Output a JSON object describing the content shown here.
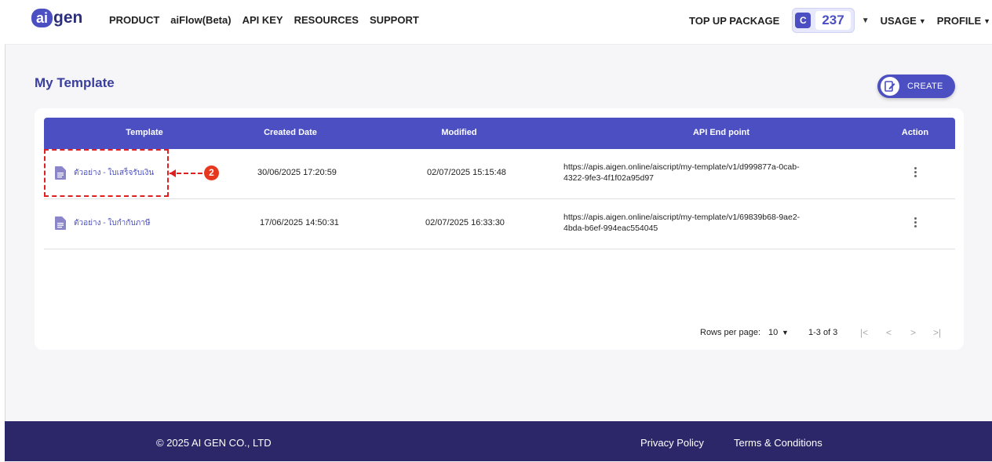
{
  "header": {
    "logo_ai": "ai",
    "logo_gen": "gen",
    "nav": [
      "PRODUCT",
      "aiFlow(Beta)",
      "API KEY",
      "RESOURCES",
      "SUPPORT"
    ],
    "topup": "TOP UP PACKAGE",
    "coin_letter": "C",
    "credits": "237",
    "usage": "USAGE",
    "profile": "PROFILE"
  },
  "page": {
    "title": "My Template",
    "create_label": "CREATE"
  },
  "table": {
    "headers": [
      "Template",
      "Created Date",
      "Modified",
      "API End point",
      "Action"
    ],
    "rows": [
      {
        "name": "ตัวอย่าง - ใบเสร็จรับเงิน",
        "created": "30/06/2025 17:20:59",
        "modified": "02/07/2025 15:15:48",
        "endpoint_line1": "https://apis.aigen.online/aiscript/my-template/v1/d999877a-0cab-",
        "endpoint_line2": "4322-9fe3-4f1f02a95d97"
      },
      {
        "name": "ตัวอย่าง - ใบกำกับภาษี",
        "created": "17/06/2025 14:50:31",
        "modified": "02/07/2025 16:33:30",
        "endpoint_line1": "https://apis.aigen.online/aiscript/my-template/v1/69839b68-9ae2-",
        "endpoint_line2": "4bda-b6ef-994eac554045"
      }
    ]
  },
  "pagination": {
    "rows_per_page_label": "Rows per page:",
    "rows_per_page_value": "10",
    "range": "1-3 of 3"
  },
  "annotation": {
    "step": "2"
  },
  "footer": {
    "copyright": "© 2025 AI GEN CO., LTD",
    "privacy": "Privacy Policy",
    "terms": "Terms & Conditions"
  },
  "colors": {
    "brand": "#4b4fc2",
    "footer": "#2c2769",
    "annotation": "#e02020"
  }
}
